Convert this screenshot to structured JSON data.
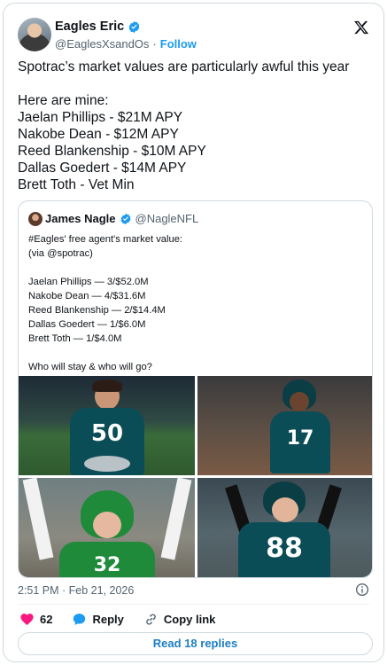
{
  "author": {
    "display_name": "Eagles Eric",
    "handle": "@EaglesXsandOs",
    "separator": "·",
    "follow_label": "Follow"
  },
  "tweet": {
    "lines": [
      "Spotrac’s market values are particularly awful this year",
      "",
      "Here are mine:",
      "Jaelan Phillips - $21M APY",
      "Nakobe Dean - $12M APY",
      "Reed Blankenship - $10M APY",
      "Dallas Goedert - $14M APY",
      "Brett Toth - Vet Min"
    ]
  },
  "quote": {
    "display_name": "James Nagle",
    "handle": "@NagleNFL",
    "lines": [
      "#Eagles' free agent's market value:",
      "(via @spotrac)",
      "",
      "Jaelan Phillips — 3/$52.0M",
      "Nakobe Dean — 4/$31.6M",
      "Reed Blankenship — 2/$14.4M",
      "Dallas Goedert — 1/$6.0M",
      "Brett Toth — 1/$4.0M",
      "",
      "Who will stay & who will go?"
    ],
    "photos": {
      "p1_number": "50",
      "p2_number": "17",
      "p3_number": "32",
      "p4_number": "88"
    }
  },
  "footer": {
    "timestamp": "2:51 PM · Feb 21, 2026",
    "like_count": "62",
    "reply_label": "Reply",
    "copy_link_label": "Copy link",
    "read_replies_label": "Read 18 replies"
  },
  "colors": {
    "accent": "#1d9bf0",
    "like": "#f91880",
    "text": "#0f1419",
    "muted": "#536471",
    "eagles_green": "#004c54",
    "kelly_green": "#1f8a3a"
  },
  "icons": [
    "verified-badge-icon",
    "x-logo-icon",
    "info-icon",
    "heart-icon",
    "reply-bubble-icon",
    "link-icon"
  ]
}
